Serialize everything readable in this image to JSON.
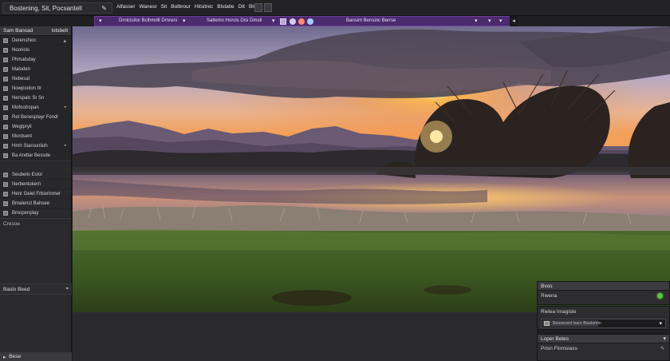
{
  "topbar": {
    "title": "Bostening, Sit, Pocsantell",
    "menus": [
      "Alfasser",
      "Wanesr",
      "Sit",
      "Bolbrour",
      "Hitsitrec",
      "Blstatie",
      "Dtt",
      "Bls"
    ]
  },
  "purplebar": {
    "left_text": "Drnlctsitor Bclhmdit Drnreni",
    "mid_text": "Saltemn Horcls Disi Dimdi",
    "right_text": "Bansint Bensinc Berrse"
  },
  "left_panel": {
    "header_left": "Sam Bansad",
    "header_right": "Istsbelt",
    "items": [
      "Derenshioc",
      "Nooriois",
      "Phmalsday",
      "Maloden",
      "Nebesal",
      "Nowpoolon Itr",
      "Nerspalc Sr Sn",
      "Mofootropan",
      "Ret Benesplayr Fondl",
      "Weglpryil",
      "Mordsent",
      "Hmh Starounlioh",
      "Ba Andtar Bessde"
    ],
    "items_b": [
      "Seubelis Eslol",
      "Nerbentokern",
      "Henr Gelel Frbiorinmer",
      "Bmalenct Bahsee",
      "Bmopenplay"
    ],
    "section_label": "Cresoe",
    "bottom_label": "Baslo Beed",
    "footer": "Bese"
  },
  "right_panel": {
    "panel1_title": "Bvos",
    "row1": "Rwena",
    "row2": "Rwlea Imagiste",
    "slider_text": "Besrecenl bars  Baolsmin",
    "slider_fraction": 0.45,
    "panel3_title": "Loper Betes",
    "panel3_row": "Prisn Flomsiass"
  },
  "colors": {
    "accent_purple": "#4b2a6e",
    "status_green": "#5cc43a"
  }
}
